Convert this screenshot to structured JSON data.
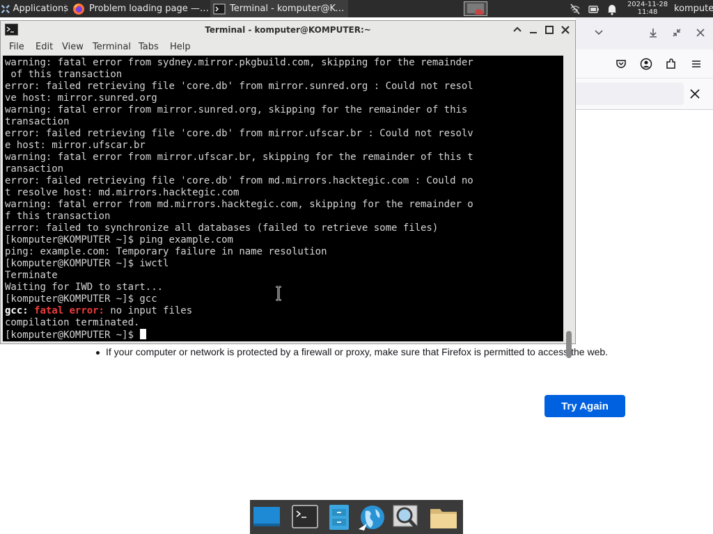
{
  "top_panel": {
    "applications_label": "Applications",
    "taskbar": [
      {
        "label": "Problem loading page — Mo...",
        "icon": "firefox-icon"
      },
      {
        "label": "Terminal - komputer@KOM...",
        "icon": "terminal-icon"
      }
    ],
    "clock_date": "2024-11-28",
    "clock_time": "11:48",
    "user_label": "komputer"
  },
  "terminal": {
    "title": "Terminal - komputer@KOMPUTER:~",
    "menu": [
      "File",
      "Edit",
      "View",
      "Terminal",
      "Tabs",
      "Help"
    ],
    "lines": [
      "warning: fatal error from sydney.mirror.pkgbuild.com, skipping for the remainder",
      " of this transaction",
      "error: failed retrieving file 'core.db' from mirror.sunred.org : Could not resol",
      "ve host: mirror.sunred.org",
      "warning: fatal error from mirror.sunred.org, skipping for the remainder of this",
      "transaction",
      "error: failed retrieving file 'core.db' from mirror.ufscar.br : Could not resolv",
      "e host: mirror.ufscar.br",
      "warning: fatal error from mirror.ufscar.br, skipping for the remainder of this t",
      "ransaction",
      "error: failed retrieving file 'core.db' from md.mirrors.hacktegic.com : Could no",
      "t resolve host: md.mirrors.hacktegic.com",
      "warning: fatal error from md.mirrors.hacktegic.com, skipping for the remainder o",
      "f this transaction",
      "error: failed to synchronize all databases (failed to retrieve some files)",
      "[komputer@KOMPUTER ~]$ ping example.com",
      "ping: example.com: Temporary failure in name resolution",
      "[komputer@KOMPUTER ~]$ iwctl",
      "Terminate",
      "Waiting for IWD to start...",
      "[komputer@KOMPUTER ~]$ gcc"
    ],
    "gcc_line": {
      "prog": "gcc:",
      "err": "fatal error:",
      "msg": " no input files"
    },
    "after_lines": [
      "compilation terminated."
    ],
    "prompt": "[komputer@KOMPUTER ~]$ "
  },
  "firefox": {
    "error_bullet": "If your computer or network is protected by a firewall or proxy, make sure that Firefox is permitted to access the web.",
    "try_again_label": "Try Again"
  },
  "dock": {
    "items": [
      "desktop-icon",
      "terminal-icon",
      "file-manager-icon",
      "web-browser-icon",
      "app-finder-icon",
      "folder-icon"
    ]
  },
  "colors": {
    "panel_bg": "#2c2c2c",
    "terminal_bg": "#000000",
    "terminal_fg": "#d6d6d6",
    "gcc_error_red": "#ef3c3c",
    "accent_blue": "#0061e0"
  }
}
